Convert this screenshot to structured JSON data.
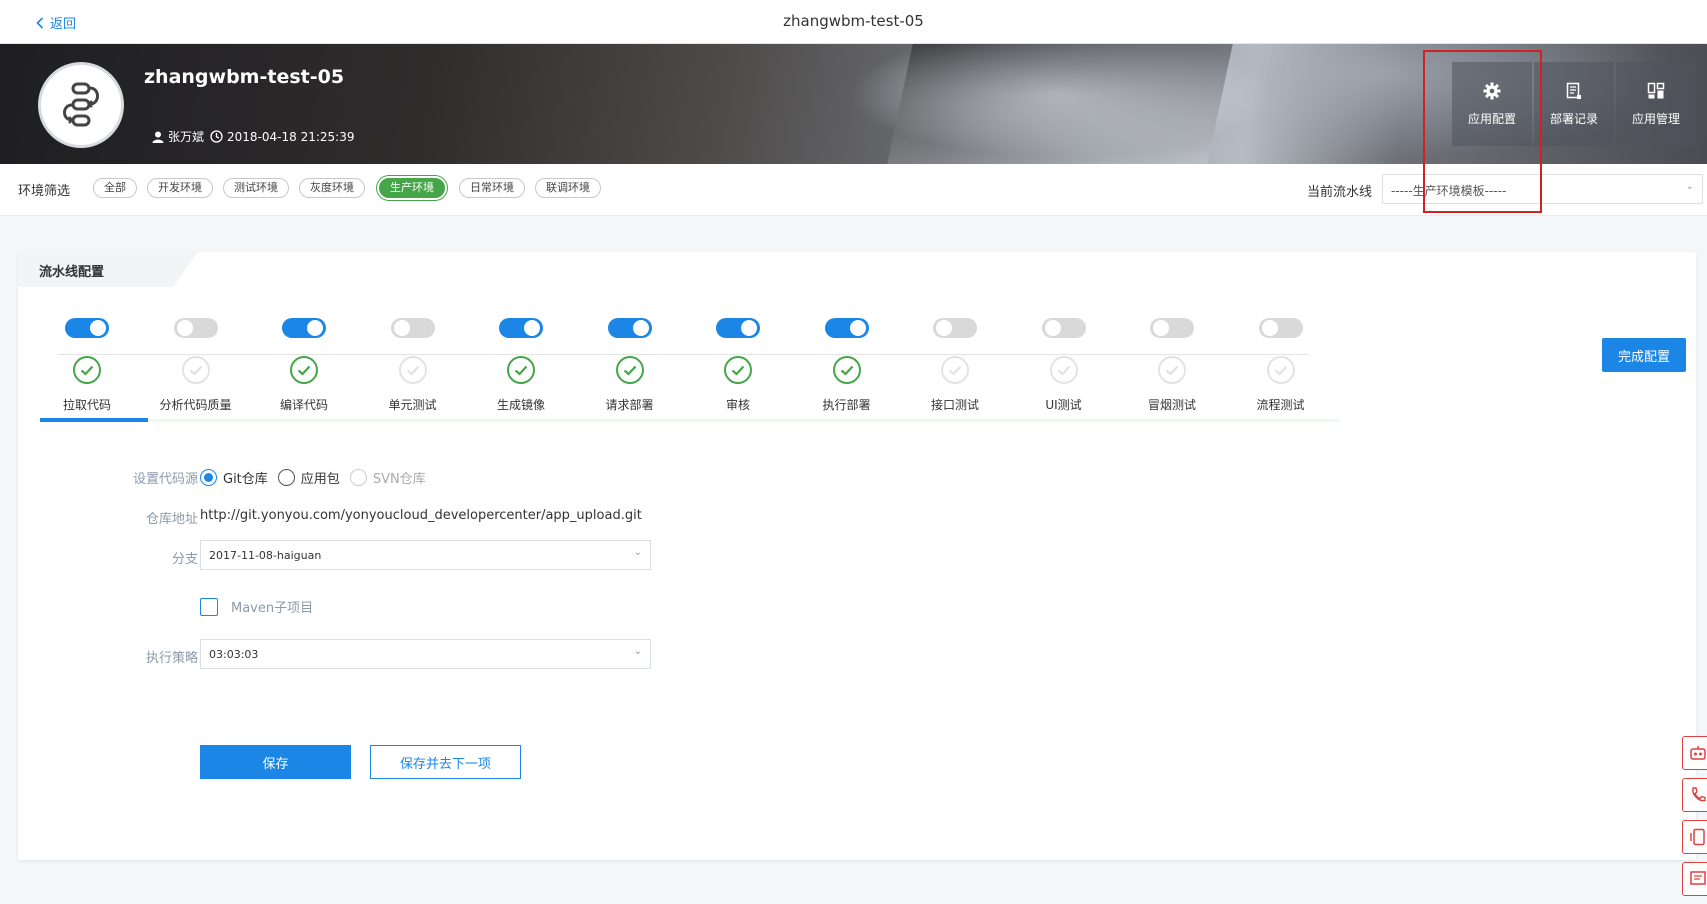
{
  "topbar": {
    "back_label": "返回",
    "title": "zhangwbm-test-05"
  },
  "banner": {
    "app_name": "zhangwbm-test-05",
    "owner": "张万斌",
    "created_at": "2018-04-18 21:25:39",
    "avatar_icon": "pipeline-flow-icon",
    "actions": [
      {
        "label": "应用配置",
        "icon": "gear-icon"
      },
      {
        "label": "部署记录",
        "icon": "document-list-icon"
      },
      {
        "label": "应用管理",
        "icon": "grid-icon"
      }
    ]
  },
  "env_filter": {
    "label": "环境筛选",
    "tags": [
      "全部",
      "开发环境",
      "测试环境",
      "灰度环境",
      "生产环境",
      "日常环境",
      "联调环境"
    ],
    "active": "生产环境",
    "pipeline_label": "当前流水线",
    "pipeline_value": "-----生产环境模板-----"
  },
  "card": {
    "tab_label": "流水线配置",
    "done_button": "完成配置",
    "steps": [
      {
        "label": "拉取代码",
        "enabled": true
      },
      {
        "label": "分析代码质量",
        "enabled": false
      },
      {
        "label": "编译代码",
        "enabled": true
      },
      {
        "label": "单元测试",
        "enabled": false
      },
      {
        "label": "生成镜像",
        "enabled": true
      },
      {
        "label": "请求部署",
        "enabled": true
      },
      {
        "label": "审核",
        "enabled": true
      },
      {
        "label": "执行部署",
        "enabled": true
      },
      {
        "label": "接口测试",
        "enabled": false
      },
      {
        "label": "UI测试",
        "enabled": false
      },
      {
        "label": "冒烟测试",
        "enabled": false
      },
      {
        "label": "流程测试",
        "enabled": false
      }
    ],
    "active_step": "拉取代码",
    "form": {
      "source_label": "设置代码源",
      "source_options": [
        "Git仓库",
        "应用包",
        "SVN仓库"
      ],
      "source_selected": "Git仓库",
      "repo_label": "仓库地址",
      "repo_url": "http://git.yonyou.com/yonyoucloud_developercenter/app_upload.git",
      "branch_label": "分支",
      "branch_value": "2017-11-08-haiguan",
      "maven_label": "Maven子项目",
      "maven_checked": false,
      "strategy_label": "执行策略",
      "strategy_value": "03:03:03"
    },
    "save_button": "保存",
    "save_next_button": "保存并去下一项"
  },
  "colors": {
    "primary": "#1b86e6",
    "success": "#44a648",
    "highlight": "#d32121"
  }
}
